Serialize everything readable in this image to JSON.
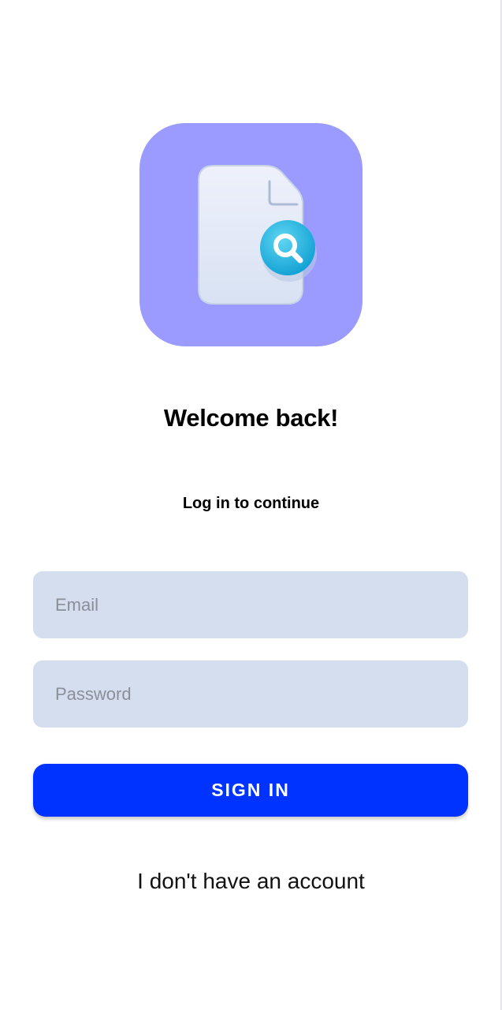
{
  "login": {
    "logo_icon": "document-search-icon",
    "title": "Welcome back!",
    "subtitle": "Log in to continue",
    "email_placeholder": "Email",
    "email_value": "",
    "password_placeholder": "Password",
    "password_value": "",
    "sign_in_label": "SIGN IN",
    "no_account_label": "I don't have an account"
  },
  "colors": {
    "logo_background": "#9b9bff",
    "input_background": "#d5deef",
    "primary_button": "#0033ff",
    "search_badge": "#1fb3e0"
  }
}
